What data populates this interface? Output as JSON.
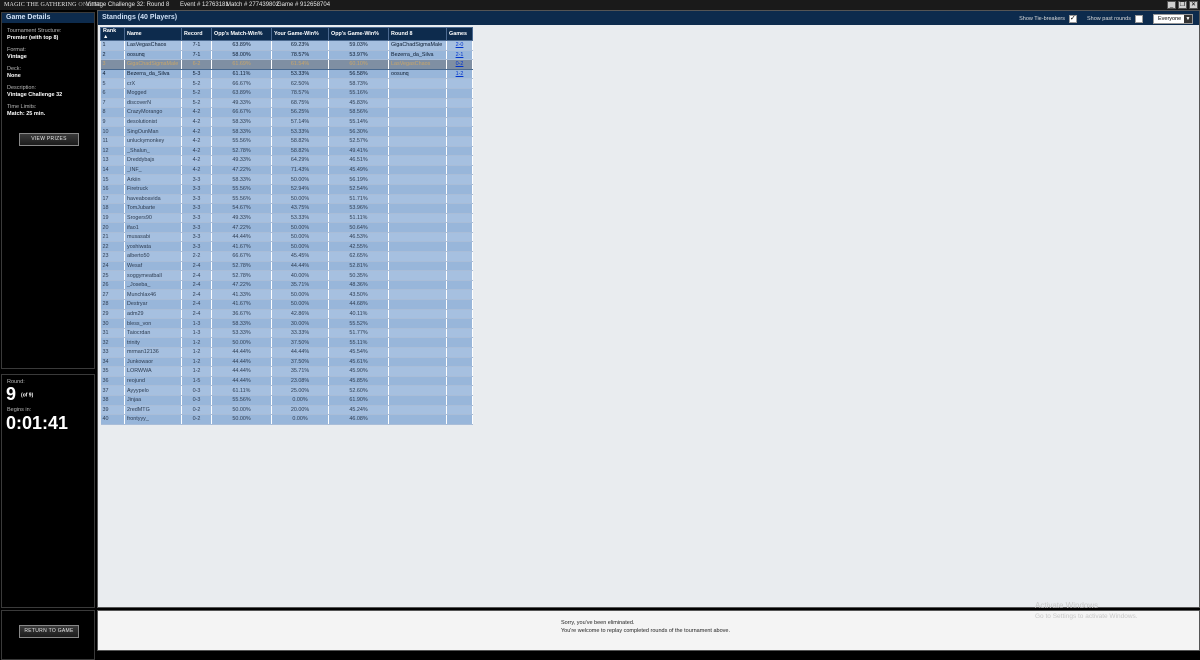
{
  "titlebar": {
    "logo": "MAGIC THE GATHERING",
    "logo_suffix": "ONLINE",
    "event_title": "Vintage Challenge 32: Round 8",
    "event_id": "Event # 12763181",
    "match_id": "Match # 277439802",
    "game_id": "Game # 912658704"
  },
  "game_details": {
    "header": "Game Details",
    "structure_label": "Tournament Structure:",
    "structure_value": "Premier (with top 8)",
    "format_label": "Format:",
    "format_value": "Vintage",
    "deck_label": "Deck:",
    "deck_value": "None",
    "description_label": "Description:",
    "description_value": "Vintage Challenge 32",
    "time_label": "Time Limits:",
    "time_value": "Match: 25 min.",
    "view_prizes": "VIEW PRIZES"
  },
  "round_info": {
    "round_label": "Round:",
    "round_number": "9",
    "round_of": "(of 9)",
    "begins_label": "Begins in:",
    "timer": "0:01:41"
  },
  "return_button": "RETURN TO GAME",
  "standings": {
    "title": "Standings (40 Players)",
    "show_tiebreakers": "Show Tie-breakers",
    "tiebreakers_checked": "✓",
    "show_past_rounds": "Show past rounds",
    "filter_value": "Everyone",
    "columns": [
      "Rank ▲",
      "Name",
      "Record",
      "Opp's Match-Win%",
      "Your Game-Win%",
      "Opp's Game-Win%",
      "Round 8",
      "Games"
    ],
    "rows": [
      [
        "1",
        "LasVegasChaos",
        "7-1",
        "63.89%",
        "69.23%",
        "59.03%",
        "GigaChadSigmaMale",
        "2-0"
      ],
      [
        "2",
        "oosunq",
        "7-1",
        "58.00%",
        "78.57%",
        "53.97%",
        "Bezerra_da_Silva",
        "2-1"
      ],
      [
        "3",
        "GigaChadSigmaMale",
        "6-2",
        "61.69%",
        "61.54%",
        "60.10%",
        "LasVegasChaos",
        "0-2"
      ],
      [
        "4",
        "Bezerra_da_Silva",
        "5-3",
        "61.11%",
        "53.33%",
        "56.58%",
        "oosunq",
        "1-2"
      ],
      [
        "5",
        "crX",
        "5-2",
        "66.67%",
        "62.50%",
        "58.73%",
        "",
        ""
      ],
      [
        "6",
        "Mogged",
        "5-2",
        "63.89%",
        "78.57%",
        "55.16%",
        "",
        ""
      ],
      [
        "7",
        "discoverN",
        "5-2",
        "49.33%",
        "68.75%",
        "45.83%",
        "",
        ""
      ],
      [
        "8",
        "CrazyMorango",
        "4-2",
        "66.67%",
        "56.25%",
        "58.56%",
        "",
        ""
      ],
      [
        "9",
        "desolutionist",
        "4-2",
        "58.33%",
        "57.14%",
        "55.14%",
        "",
        ""
      ],
      [
        "10",
        "SingOunMan",
        "4-2",
        "58.33%",
        "53.33%",
        "56.30%",
        "",
        ""
      ],
      [
        "11",
        "unluckymonkey",
        "4-2",
        "55.56%",
        "58.82%",
        "52.57%",
        "",
        ""
      ],
      [
        "12",
        "_Shalun_",
        "4-2",
        "52.78%",
        "58.82%",
        "49.41%",
        "",
        ""
      ],
      [
        "13",
        "Dreddybajs",
        "4-2",
        "49.33%",
        "64.29%",
        "46.51%",
        "",
        ""
      ],
      [
        "14",
        "_INF_",
        "4-2",
        "47.22%",
        "71.43%",
        "45.49%",
        "",
        ""
      ],
      [
        "15",
        "Arkiin",
        "3-3",
        "58.33%",
        "50.00%",
        "56.19%",
        "",
        ""
      ],
      [
        "16",
        "Firetruck",
        "3-3",
        "55.56%",
        "52.94%",
        "52.54%",
        "",
        ""
      ],
      [
        "17",
        "haveaboavida",
        "3-3",
        "55.56%",
        "50.00%",
        "51.71%",
        "",
        ""
      ],
      [
        "18",
        "TomJubarte",
        "3-3",
        "54.67%",
        "43.75%",
        "53.96%",
        "",
        ""
      ],
      [
        "19",
        "Srogers90",
        "3-3",
        "49.33%",
        "53.33%",
        "51.11%",
        "",
        ""
      ],
      [
        "20",
        "ifao1",
        "3-3",
        "47.22%",
        "50.00%",
        "50.64%",
        "",
        ""
      ],
      [
        "21",
        "musasabi",
        "3-3",
        "44.44%",
        "50.00%",
        "46.53%",
        "",
        ""
      ],
      [
        "22",
        "yoshiwata",
        "3-3",
        "41.67%",
        "50.00%",
        "42.55%",
        "",
        ""
      ],
      [
        "23",
        "alberto50",
        "2-2",
        "66.67%",
        "45.45%",
        "62.65%",
        "",
        ""
      ],
      [
        "24",
        "Wesaf",
        "2-4",
        "52.78%",
        "44.44%",
        "52.81%",
        "",
        ""
      ],
      [
        "25",
        "soggymeatball",
        "2-4",
        "52.78%",
        "40.00%",
        "50.35%",
        "",
        ""
      ],
      [
        "26",
        "_Joseba_",
        "2-4",
        "47.22%",
        "35.71%",
        "48.36%",
        "",
        ""
      ],
      [
        "27",
        "Munchlax46",
        "2-4",
        "41.33%",
        "50.00%",
        "43.50%",
        "",
        ""
      ],
      [
        "28",
        "Destryar",
        "2-4",
        "41.67%",
        "50.00%",
        "44.68%",
        "",
        ""
      ],
      [
        "29",
        "adm29",
        "2-4",
        "36.67%",
        "42.86%",
        "40.11%",
        "",
        ""
      ],
      [
        "30",
        "bless_von",
        "1-3",
        "58.33%",
        "30.00%",
        "55.52%",
        "",
        ""
      ],
      [
        "31",
        "Taiocrdan",
        "1-3",
        "53.33%",
        "33.33%",
        "51.77%",
        "",
        ""
      ],
      [
        "32",
        "trinity",
        "1-2",
        "50.00%",
        "37.50%",
        "55.11%",
        "",
        ""
      ],
      [
        "33",
        "mrman12136",
        "1-2",
        "44.44%",
        "44.44%",
        "45.54%",
        "",
        ""
      ],
      [
        "34",
        "Junkowaor",
        "1-2",
        "44.44%",
        "37.50%",
        "45.61%",
        "",
        ""
      ],
      [
        "35",
        "LORWWA",
        "1-2",
        "44.44%",
        "35.71%",
        "45.90%",
        "",
        ""
      ],
      [
        "36",
        "reojund",
        "1-5",
        "44.44%",
        "23.08%",
        "45.85%",
        "",
        ""
      ],
      [
        "37",
        "Ayyypelo",
        "0-3",
        "61.11%",
        "25.00%",
        "52.60%",
        "",
        ""
      ],
      [
        "38",
        "Jinjaa",
        "0-3",
        "55.56%",
        "0.00%",
        "61.90%",
        "",
        ""
      ],
      [
        "39",
        "2redMTG",
        "0-2",
        "50.00%",
        "20.00%",
        "45.24%",
        "",
        ""
      ],
      [
        "40",
        "frontyyy_",
        "0-2",
        "50.00%",
        "0.00%",
        "46.08%",
        "",
        ""
      ]
    ]
  },
  "footer": {
    "line1": "Sorry, you've been eliminated.",
    "line2": "You're welcome to replay completed rounds of the tournament above."
  },
  "watermark": {
    "line1": "Activate Windows",
    "line2": "Go to Settings to activate Windows."
  }
}
